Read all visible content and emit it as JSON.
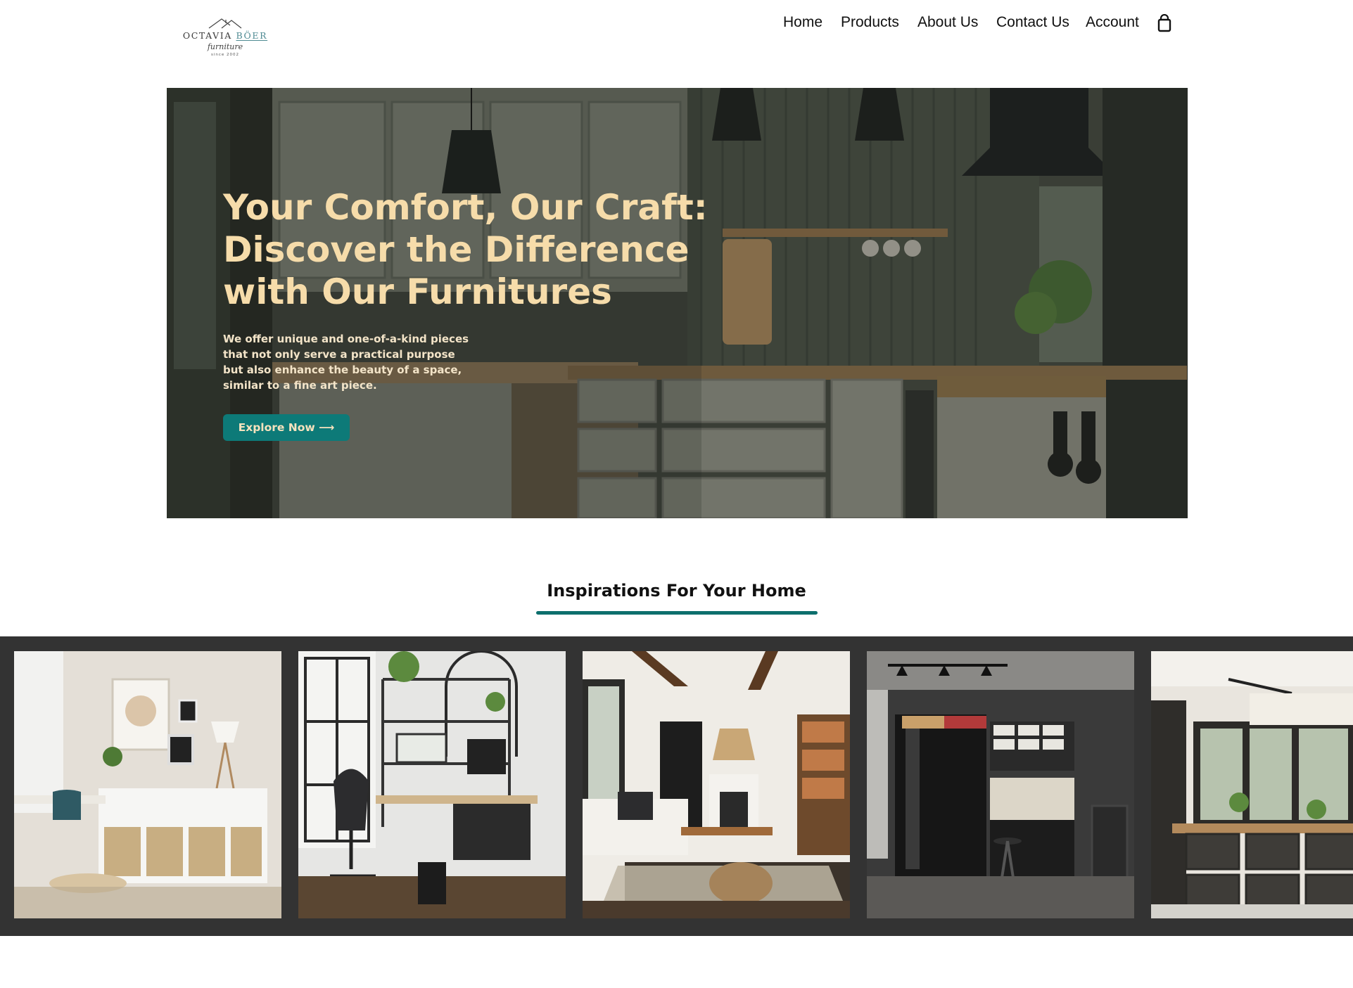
{
  "brand": {
    "name_part1": "OCTAVIA",
    "name_part2": "BÖER",
    "tagline": "furniture",
    "since": "since 2002"
  },
  "nav": {
    "links": [
      "Home",
      "Products",
      "About Us",
      "Contact Us",
      "Account"
    ],
    "cart_icon": "shopping-bag-icon"
  },
  "hero": {
    "title": "Your Comfort, Our Craft: Discover the Difference with Our Furnitures",
    "description": "We offer unique and one-of-a-kind pieces that not only serve a practical purpose but also enhance the beauty of a space, similar to a fine art piece.",
    "cta_label": "Explore Now ⟶"
  },
  "inspirations": {
    "title": "Inspirations For Your Home",
    "images": [
      "dining-shelving-room",
      "home-office-desk",
      "living-room-sofa",
      "garage-workshop-storage",
      "dark-kitchen-cabinets"
    ]
  },
  "colors": {
    "accent": "#0d7a78",
    "hero_text": "#f6dcaa",
    "gallery_bg": "#333333"
  }
}
